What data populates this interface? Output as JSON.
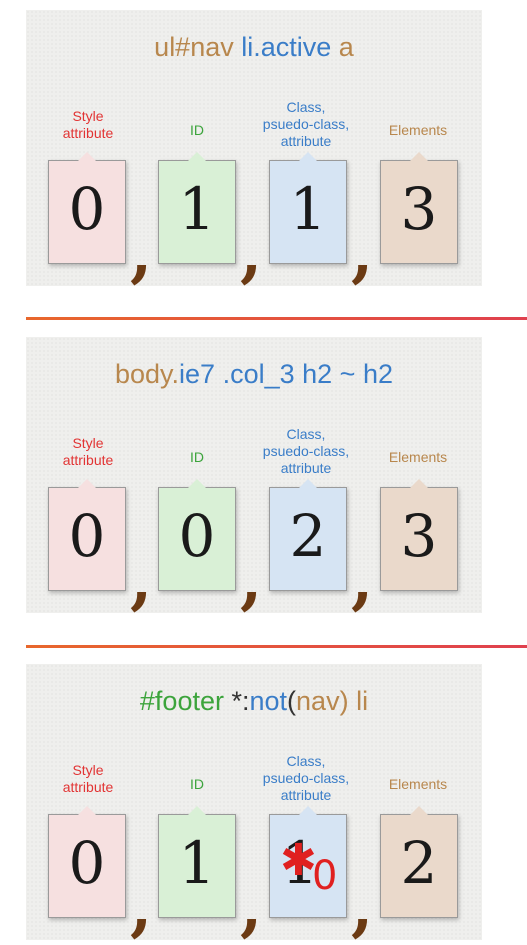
{
  "panels": [
    {
      "selector_parts": [
        "ul#nav ",
        "li.",
        "active ",
        "a"
      ],
      "categories": [
        "Style\nattribute",
        "ID",
        "Class,\npsuedo-class,\nattribute",
        "Elements"
      ],
      "values": [
        "0",
        "1",
        "1",
        "3"
      ],
      "comma": ","
    },
    {
      "selector_parts": [
        "body.",
        "ie7 .col_3 ",
        "h2 ~ h2"
      ],
      "categories": [
        "Style\nattribute",
        "ID",
        "Class,\npsuedo-class,\nattribute",
        "Elements"
      ],
      "values": [
        "0",
        "0",
        "2",
        "3"
      ],
      "comma": ","
    },
    {
      "selector_parts": [
        "#footer ",
        "*:",
        "not",
        "(",
        "nav",
        ") li"
      ],
      "categories": [
        "Style\nattribute",
        "ID",
        "Class,\npsuedo-class,\nattribute",
        "Elements"
      ],
      "values": [
        "0",
        "1",
        "1",
        "2"
      ],
      "correction": "0",
      "comma": ","
    }
  ],
  "colors": {
    "style": "#e23434",
    "id": "#3ca43c",
    "class": "#3a7dc8",
    "elements": "#b8874d",
    "comma": "#6b3a13",
    "separator_start": "#e8672c",
    "separator_end": "#e0404e"
  }
}
